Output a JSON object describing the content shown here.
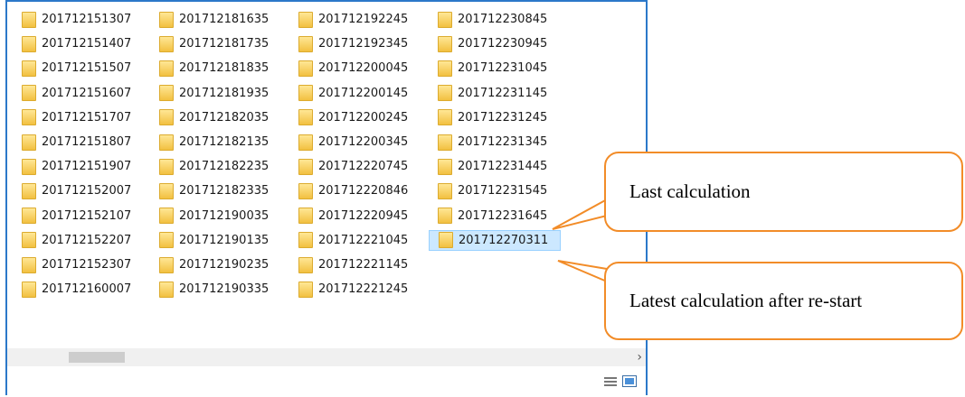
{
  "files": [
    "201712151307",
    "201712151407",
    "201712151507",
    "201712151607",
    "201712151707",
    "201712151807",
    "201712151907",
    "201712152007",
    "201712152107",
    "201712152207",
    "201712152307",
    "201712160007",
    "201712181635",
    "201712181735",
    "201712181835",
    "201712181935",
    "201712182035",
    "201712182135",
    "201712182235",
    "201712182335",
    "201712190035",
    "201712190135",
    "201712190235",
    "201712190335",
    "201712192245",
    "201712192345",
    "201712200045",
    "201712200145",
    "201712200245",
    "201712200345",
    "201712220745",
    "201712220846",
    "201712220945",
    "201712221045",
    "201712221145",
    "201712221245",
    "201712230845",
    "201712230945",
    "201712231045",
    "201712231145",
    "201712231245",
    "201712231345",
    "201712231445",
    "201712231545",
    "201712231645",
    "201712270311"
  ],
  "selected_file": "201712270311",
  "annotations": {
    "last_calculation": "Last calculation",
    "latest_after_restart": "Latest calculation after re-start"
  },
  "colors": {
    "callout_border": "#f28c28",
    "selection": "#cce8ff",
    "window_border": "#2b78c9"
  }
}
